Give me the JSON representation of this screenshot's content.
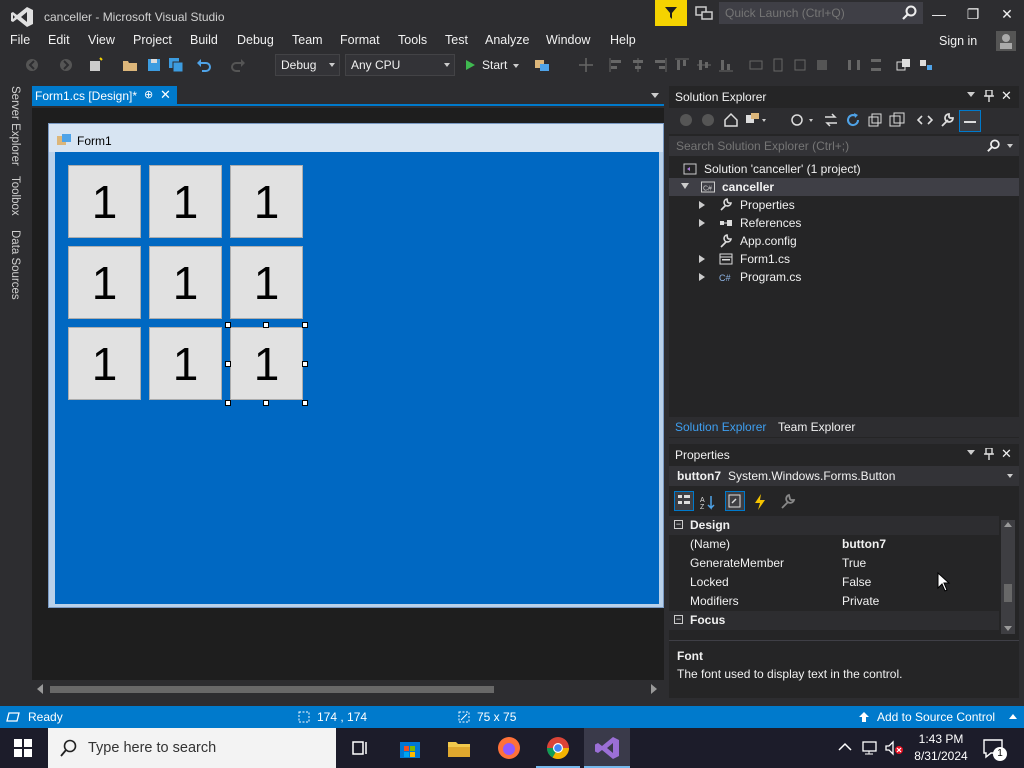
{
  "window": {
    "title": "canceller - Microsoft Visual Studio",
    "quick_launch_placeholder": "Quick Launch (Ctrl+Q)",
    "min": "—",
    "restore": "❐",
    "close": "✕"
  },
  "menu": {
    "items": [
      "File",
      "Edit",
      "View",
      "Project",
      "Build",
      "Debug",
      "Team",
      "Format",
      "Tools",
      "Test",
      "Analyze",
      "Window",
      "Help"
    ],
    "sign_in": "Sign in"
  },
  "toolbar": {
    "config": "Debug",
    "platform": "Any CPU",
    "start": "Start"
  },
  "left_rail": [
    "Server Explorer",
    "Toolbox",
    "Data Sources"
  ],
  "document": {
    "tab_label": "Form1.cs [Design]*",
    "pin": "⊕",
    "close": "✕"
  },
  "form": {
    "title": "Form1",
    "buttons": [
      "1",
      "1",
      "1",
      "1",
      "1",
      "1",
      "1",
      "1",
      "1"
    ],
    "selected_index": 8
  },
  "solution_explorer": {
    "title": "Solution Explorer",
    "search_placeholder": "Search Solution Explorer (Ctrl+;)",
    "solution": "Solution 'canceller' (1 project)",
    "project": "canceller",
    "items": [
      {
        "label": "Properties",
        "icon": "wrench-icon",
        "expandable": true
      },
      {
        "label": "References",
        "icon": "references-icon",
        "expandable": true
      },
      {
        "label": "App.config",
        "icon": "config-file-icon",
        "expandable": false
      },
      {
        "label": "Form1.cs",
        "icon": "form-file-icon",
        "expandable": true
      },
      {
        "label": "Program.cs",
        "icon": "csharp-file-icon",
        "expandable": true
      }
    ],
    "tabs": [
      "Solution Explorer",
      "Team Explorer"
    ]
  },
  "properties": {
    "title": "Properties",
    "object_name": "button7",
    "object_type": "System.Windows.Forms.Button",
    "categories": [
      {
        "name": "Design",
        "rows": [
          {
            "name": "(Name)",
            "value": "button7",
            "bold": true
          },
          {
            "name": "GenerateMember",
            "value": "True"
          },
          {
            "name": "Locked",
            "value": "False"
          },
          {
            "name": "Modifiers",
            "value": "Private"
          }
        ]
      },
      {
        "name": "Focus",
        "rows": []
      }
    ],
    "description_title": "Font",
    "description_text": "The font used to display text in the control."
  },
  "status": {
    "state": "Ready",
    "position": "174 , 174",
    "size": "75 x 75",
    "source_control": "Add to Source Control"
  },
  "taskbar": {
    "search_placeholder": "Type here to search",
    "time": "1:43 PM",
    "date": "8/31/2024",
    "notification_count": "1"
  },
  "colors": {
    "accent": "#007acc",
    "form_client": "#0068c2",
    "filter_yellow": "#f5d300"
  }
}
